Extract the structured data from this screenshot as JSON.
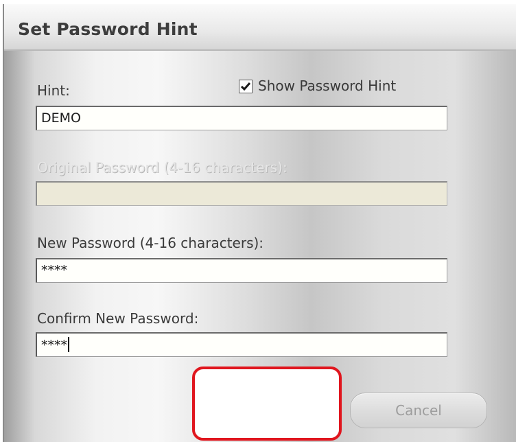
{
  "dialog": {
    "title": "Set Password Hint",
    "hint": {
      "label": "Hint:",
      "value": "DEMO"
    },
    "show_hint": {
      "label": "Show Password Hint",
      "checked": true
    },
    "original_password": {
      "label": "Original Password (4-16 characters):",
      "value": "",
      "disabled": true
    },
    "new_password": {
      "label": "New Password (4-16 characters):",
      "value": "****"
    },
    "confirm_password": {
      "label": "Confirm New Password:",
      "value": "****"
    },
    "buttons": {
      "ok_label": "",
      "cancel_label": "Cancel"
    }
  },
  "colors": {
    "highlight_border": "#e0161e",
    "title_text": "#3d3d3d"
  }
}
